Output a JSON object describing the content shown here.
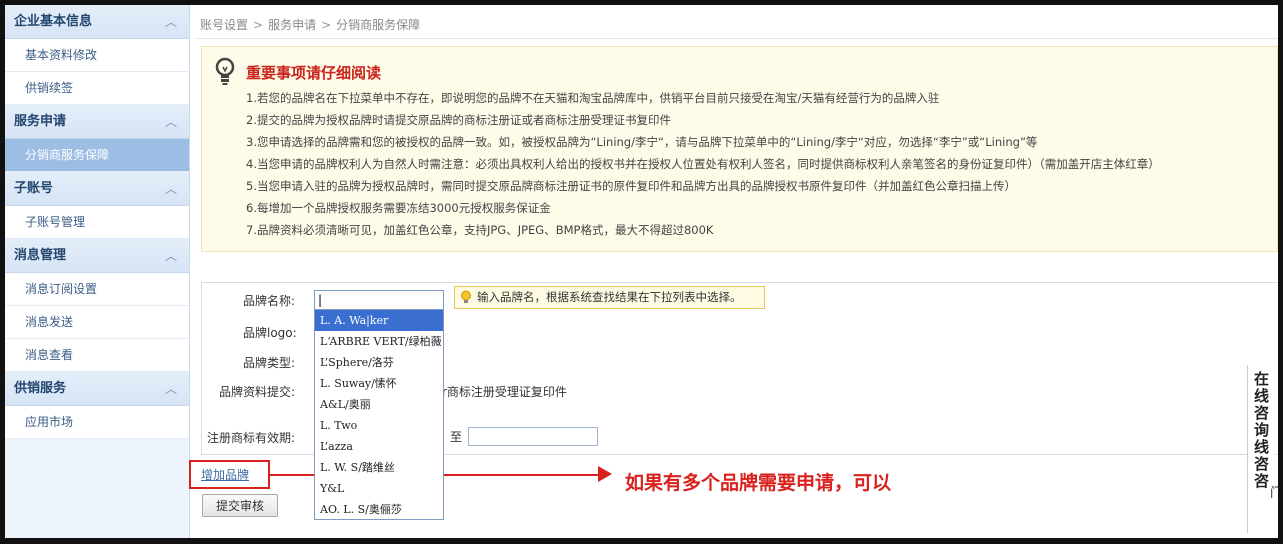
{
  "sidebar": {
    "sections": [
      {
        "title": "企业基本信息",
        "items": [
          "基本资料修改",
          "供销续签"
        ]
      },
      {
        "title": "服务申请",
        "items": [
          "分销商服务保障"
        ]
      },
      {
        "title": "子账号",
        "items": [
          "子账号管理"
        ]
      },
      {
        "title": "消息管理",
        "items": [
          "消息订阅设置",
          "消息发送",
          "消息查看"
        ]
      },
      {
        "title": "供销服务",
        "items": [
          "应用市场"
        ]
      }
    ],
    "active_item": "分销商服务保障",
    "chevron_glyph": "︿"
  },
  "breadcrumb": [
    "账号设置",
    "服务申请",
    "分销商服务保障"
  ],
  "breadcrumb_sep": ">",
  "notice": {
    "title": "重要事项请仔细阅读",
    "items": [
      "1.若您的品牌名在下拉菜单中不存在，即说明您的品牌不在天猫和淘宝品牌库中，供销平台目前只接受在淘宝/天猫有经营行为的品牌入驻",
      "2.提交的品牌为授权品牌时请提交原品牌的商标注册证或者商标注册受理证书复印件",
      "3.您申请选择的品牌需和您的被授权的品牌一致。如，被授权品牌为“Lining/李宁“，请与品牌下拉菜单中的“Lining/李宁“对应，勿选择“李宁”或“Lining”等",
      "4.当您申请的品牌权利人为自然人时需注意：必须出具权利人给出的授权书并在授权人位置处有权利人签名，同时提供商标权利人亲笔签名的身份证复印件）（需加盖开店主体红章）",
      "5.当您申请入驻的品牌为授权品牌时，需同时提交原品牌商标注册证书的原件复印件和品牌方出具的品牌授权书原件复印件（并加盖红色公章扫描上传）",
      "6.每增加一个品牌授权服务需要冻结3000元授权服务保证金",
      "7.品牌资料必须清晰可见，加盖红色公章，支持JPG、JPEG、BMP格式，最大不得超过800K"
    ]
  },
  "form": {
    "brand_name_label": "品牌名称:",
    "brand_name_value": "|",
    "brand_logo_label": "品牌logo:",
    "brand_type_label": "品牌类型:",
    "brand_docs_label": "品牌资料提交:",
    "brand_docs_partial": "r商标注册受理证复印件",
    "trademark_valid_label": "注册商标有效期:",
    "to_label": "至",
    "tip": "输入品牌名，根据系统查找结果在下拉列表中选择。",
    "add_brand": "增加品牌",
    "submit": "提交审核"
  },
  "dropdown": {
    "options": [
      "L. A. Wa|ker",
      "L‘ARBRE VERT/绿柏薇",
      "L’Sphere/洛芬",
      "L. Suway/愫怀",
      "A&L/奥丽",
      "L. Two",
      "L’azza",
      "L. W. S/踏维丝",
      "Y&L",
      "AO. L. S/奥俪莎"
    ],
    "highlighted_index": 0
  },
  "annotation": "如果有多个品牌需要申请，可以",
  "side_chat": "在线咨询线咨咨",
  "edge_glyph": "门",
  "colors": {
    "accent_red": "#d9211d",
    "highlight_blue": "#3a6fd1",
    "sidebar_active": "#9cbde4",
    "notice_bg": "#fffbe9"
  }
}
